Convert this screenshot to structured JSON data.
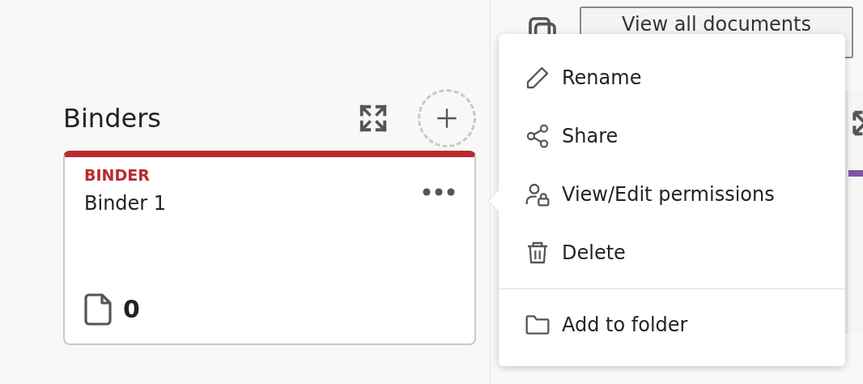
{
  "header": {
    "button": "View all documents"
  },
  "binders": {
    "title": "Binders",
    "cards": [
      {
        "type_label": "BINDER",
        "name": "Binder 1",
        "document_count": "0",
        "color": "#b92b2f"
      }
    ]
  },
  "context_menu": {
    "groups": [
      [
        {
          "kind": "rename",
          "label": "Rename"
        },
        {
          "kind": "share",
          "label": "Share"
        },
        {
          "kind": "permissions",
          "label": "View/Edit permissions"
        },
        {
          "kind": "delete",
          "label": "Delete"
        }
      ],
      [
        {
          "kind": "folder",
          "label": "Add to folder"
        }
      ]
    ]
  }
}
